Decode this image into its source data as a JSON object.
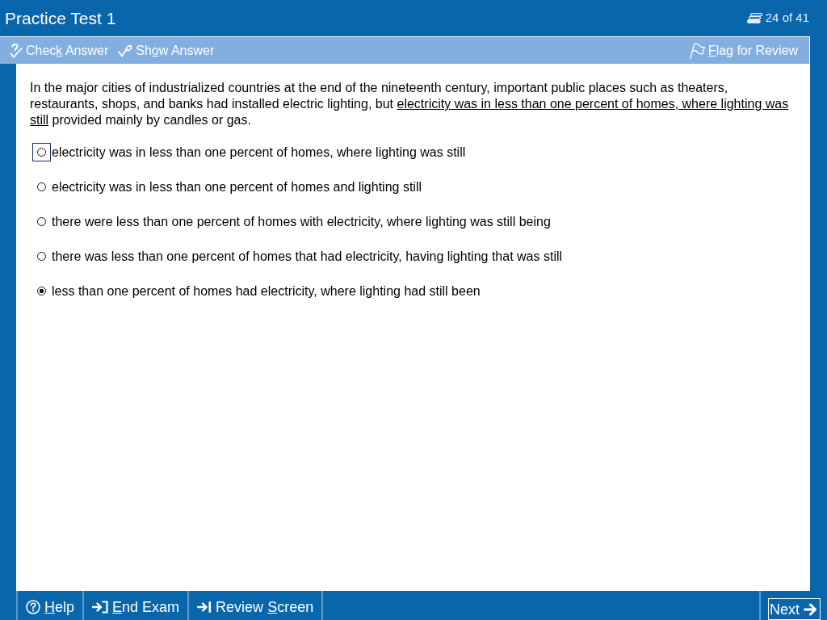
{
  "window": {
    "title": "Practice Test 1",
    "progress": "24 of 41"
  },
  "toolbar": {
    "left": [
      {
        "kind": "check-answer",
        "label": [
          {
            "text": "Chec",
            "underlined": false
          },
          {
            "text": "k",
            "underlined": true
          },
          {
            "text": " Answer",
            "underlined": false
          }
        ]
      },
      {
        "kind": "show-answer",
        "label": [
          {
            "text": "Sh",
            "underlined": false
          },
          {
            "text": "o",
            "underlined": true
          },
          {
            "text": "w Answer",
            "underlined": false
          }
        ]
      }
    ],
    "right": [
      {
        "kind": "flag",
        "label": [
          {
            "text": "F",
            "underlined": true
          },
          {
            "text": "lag for Review",
            "underlined": false
          }
        ]
      }
    ]
  },
  "question": {
    "passage": [
      {
        "text": "In the major cities of industrialized countries at the end of the nineteenth century, important public places such as theaters, restaurants, shops, and banks had installed electric lighting, but ",
        "underlined": false
      },
      {
        "text": "electricity was in less than one percent of homes, where lighting was still",
        "underlined": true
      },
      {
        "text": " provided mainly by candles or gas.",
        "underlined": false
      }
    ],
    "options": [
      {
        "text": "electricity was in less than one percent of homes, where lighting was still",
        "selected": false,
        "focused": true
      },
      {
        "text": "electricity was in less than one percent of homes and lighting still",
        "selected": false,
        "focused": false
      },
      {
        "text": "there were less than one percent of homes with electricity, where lighting was still being",
        "selected": false,
        "focused": false
      },
      {
        "text": "there was less than one percent of homes that had electricity, having lighting that was still",
        "selected": false,
        "focused": false
      },
      {
        "text": "less than one percent of homes had electricity, where lighting had still been",
        "selected": true,
        "focused": false
      }
    ]
  },
  "footer": {
    "left": [
      {
        "kind": "help",
        "focused": false,
        "label": [
          {
            "text": "H",
            "underlined": true
          },
          {
            "text": "elp",
            "underlined": false
          }
        ]
      },
      {
        "kind": "end-exam",
        "focused": false,
        "label": [
          {
            "text": "E",
            "underlined": true
          },
          {
            "text": "nd Exam",
            "underlined": false
          }
        ]
      },
      {
        "kind": "review-screen",
        "focused": false,
        "label": [
          {
            "text": "Review ",
            "underlined": false
          },
          {
            "text": "S",
            "underlined": true
          },
          {
            "text": "creen",
            "underlined": false
          }
        ]
      }
    ],
    "right": [
      {
        "kind": "next",
        "focused": true,
        "label": [
          {
            "text": "Next",
            "underlined": false
          }
        ]
      }
    ]
  }
}
